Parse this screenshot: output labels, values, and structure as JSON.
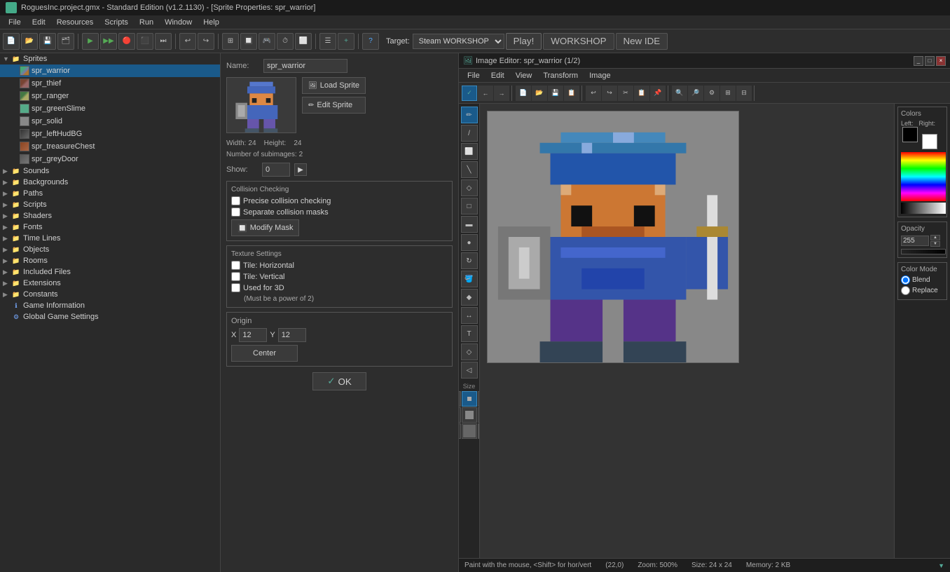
{
  "titlebar": {
    "title": "RoguesInc.project.gmx  -  Standard Edition (v1.2.1130) - [Sprite Properties: spr_warrior]"
  },
  "menubar": {
    "items": [
      "File",
      "Edit",
      "Resources",
      "Scripts",
      "Run",
      "Window",
      "Help"
    ]
  },
  "toolbar": {
    "target_label": "Target:",
    "target_value": "Steam WORKSHOP",
    "play_label": "Play!",
    "workshop_label": "WORKSHOP",
    "new_ide_label": "New IDE"
  },
  "sprite_props": {
    "name_label": "Name:",
    "name_value": "spr_warrior",
    "load_sprite_label": "Load Sprite",
    "edit_sprite_label": "Edit Sprite",
    "width_label": "Width:",
    "width_value": "24",
    "height_label": "Height:",
    "height_value": "24",
    "subimages_label": "Number of subimages:",
    "subimages_value": "2",
    "show_label": "Show:",
    "show_value": "0",
    "collision_group_title": "Collision Checking",
    "precise_label": "Precise collision checking",
    "separate_label": "Separate collision masks",
    "modify_mask_label": "Modify Mask",
    "texture_group_title": "Texture Settings",
    "tile_h_label": "Tile: Horizontal",
    "tile_v_label": "Tile: Vertical",
    "used_3d_label": "Used for 3D",
    "used_3d_sub": "(Must be a power of 2)",
    "origin_title": "Origin",
    "x_label": "X",
    "x_value": "12",
    "y_label": "Y",
    "y_value": "12",
    "center_label": "Center",
    "ok_label": "✓ OK"
  },
  "resource_tree": {
    "sprites_label": "Sprites",
    "sprite_items": [
      {
        "name": "spr_warrior",
        "selected": true
      },
      {
        "name": "spr_thief",
        "selected": false
      },
      {
        "name": "spr_ranger",
        "selected": false
      },
      {
        "name": "spr_greenSlime",
        "selected": false
      },
      {
        "name": "spr_solid",
        "selected": false
      },
      {
        "name": "spr_leftHudBG",
        "selected": false
      },
      {
        "name": "spr_treasureChest",
        "selected": false
      },
      {
        "name": "spr_greyDoor",
        "selected": false
      }
    ],
    "sounds_label": "Sounds",
    "backgrounds_label": "Backgrounds",
    "paths_label": "Paths",
    "scripts_label": "Scripts",
    "shaders_label": "Shaders",
    "fonts_label": "Fonts",
    "timelines_label": "Time Lines",
    "objects_label": "Objects",
    "rooms_label": "Rooms",
    "included_files_label": "Included Files",
    "extensions_label": "Extensions",
    "constants_label": "Constants",
    "game_info_label": "Game Information",
    "global_settings_label": "Global Game Settings"
  },
  "image_editor": {
    "title": "Image Editor: spr_warrior (1/2)",
    "menus": [
      "File",
      "Edit",
      "View",
      "Transform",
      "Image"
    ],
    "status_paint": "Paint with the mouse, <Shift> for hor/vert",
    "status_coords": "(22,0)",
    "zoom_label": "Zoom: 500%",
    "size_label": "Size: 24 x 24",
    "memory_label": "Memory: 2 KB",
    "colors_title": "Colors",
    "left_label": "Left:",
    "right_label": "Right:",
    "opacity_title": "Opacity",
    "opacity_value": "255",
    "color_mode_title": "Color Mode",
    "blend_label": "Blend",
    "replace_label": "Replace",
    "size_section_title": "Size"
  }
}
